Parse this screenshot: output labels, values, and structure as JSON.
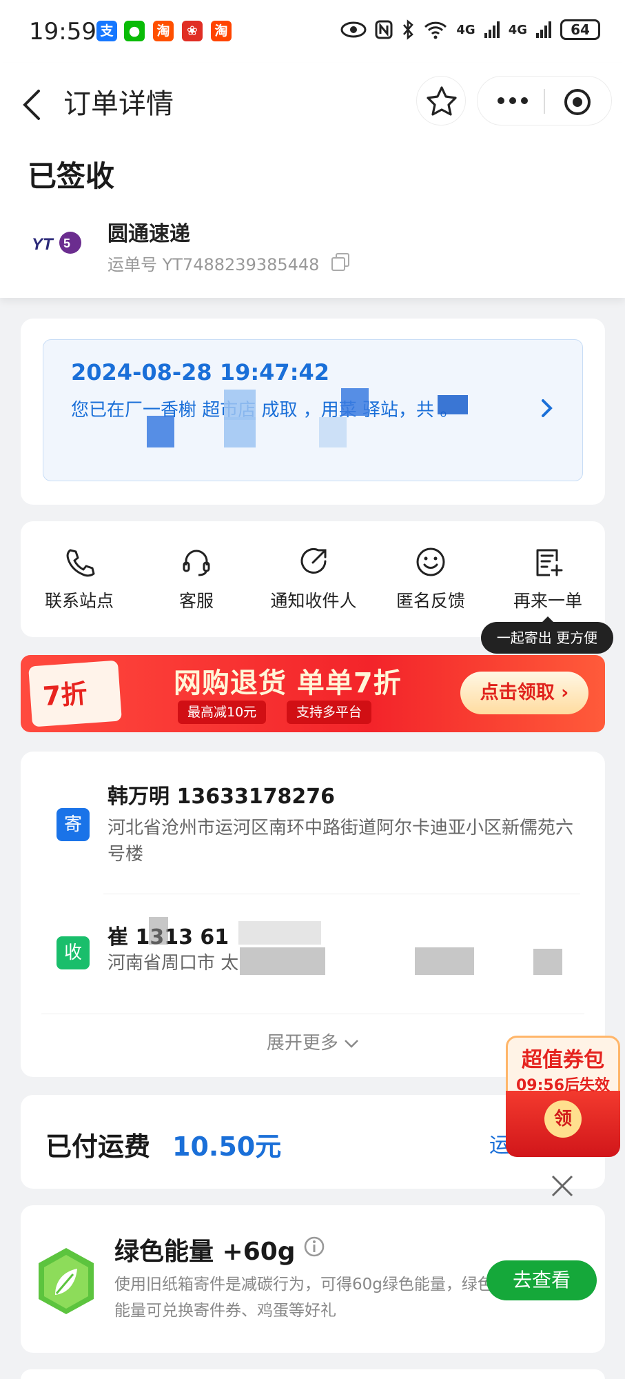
{
  "status_bar": {
    "time": "19:59",
    "app_icons": [
      {
        "glyph": "支",
        "color": "#1677ff"
      },
      {
        "glyph": "微",
        "color": "#09bb07"
      },
      {
        "glyph": "淘",
        "color": "#ff5000"
      },
      {
        "glyph": "拼",
        "color": "#e02e24"
      },
      {
        "glyph": "淘",
        "color": "#ff4400"
      }
    ],
    "net1": "4G",
    "net2": "4G",
    "battery": "64"
  },
  "header": {
    "title": "订单详情",
    "order_status": "已签收",
    "carrier": "圆通速递",
    "waybill": "运单号 YT7488239385448",
    "logo_text": "YT"
  },
  "pickup": {
    "time": "2024-08-28 19:47:42",
    "message": "您已在厂一香榭 超市店 成取 ，用菜 驿站，共 。"
  },
  "actions": [
    {
      "label": "联系站点",
      "icon": "phone-icon"
    },
    {
      "label": "客服",
      "icon": "headset-icon"
    },
    {
      "label": "通知收件人",
      "icon": "notify-icon"
    },
    {
      "label": "匿名反馈",
      "icon": "smile-icon"
    },
    {
      "label": "再来一单",
      "icon": "reorder-icon"
    }
  ],
  "tooltip": "一起寄出 更方便",
  "banner": {
    "badge": "7折",
    "title": "网购退货 单单7折",
    "chip1": "最高减10元",
    "chip2": "支持多平台",
    "cta": "点击领取 ›"
  },
  "sender": {
    "tag": "寄",
    "name": "韩万明 13633178276",
    "address": "河北省沧州市运河区南环中路街道阿尔卡迪亚小区新儒苑六号楼"
  },
  "receiver": {
    "tag": "收",
    "name": "崔 1313 61",
    "address": "河南省周口市 太 "
  },
  "expand_label": "展开更多",
  "fee": {
    "label": "已付运费",
    "value": "10.50元",
    "link": "运"
  },
  "coupon": {
    "title": "超值券包",
    "timer": "09:56后失效",
    "button": "领"
  },
  "energy": {
    "title": "绿色能量 +60g",
    "desc": "使用旧纸箱寄件是减碳行为，可得60g绿色能量，绿色能量可兑换寄件券、鸡蛋等好礼",
    "button": "去查看"
  },
  "colors": {
    "accent_blue": "#1a6fd8",
    "sender_tag": "#1a73e8",
    "receiver_tag": "#19be6b",
    "energy_button": "#15a83a",
    "banner_red": "#f3242a"
  }
}
